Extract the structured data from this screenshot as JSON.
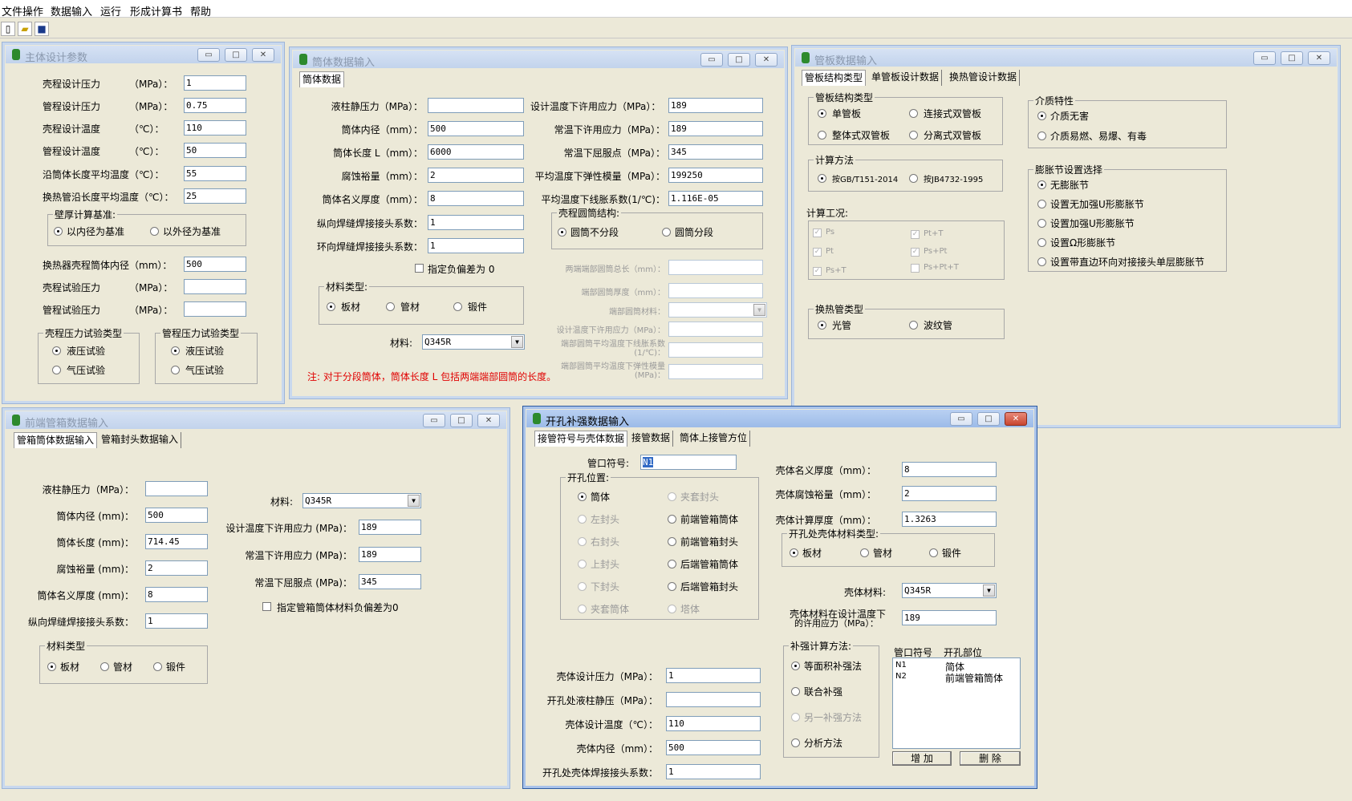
{
  "menu": {
    "items": [
      "文件操作",
      "数据输入",
      "运行",
      "形成计算书",
      "帮助"
    ]
  },
  "toolbar": {
    "new_icon": "new-file-icon",
    "open_icon": "open-folder-icon",
    "save_icon": "save-disk-icon"
  },
  "window_buttons": {
    "min": "▭",
    "max": "□",
    "close": "✕"
  },
  "w1": {
    "title": "主体设计参数",
    "rows": [
      {
        "label": "壳程设计压力",
        "unit": "（MPa）：",
        "value": "1"
      },
      {
        "label": "管程设计压力",
        "unit": "（MPa）：",
        "value": "0.75"
      },
      {
        "label": "壳程设计温度",
        "unit": "（℃）：",
        "value": "110"
      },
      {
        "label": "管程设计温度",
        "unit": "（℃）：",
        "value": "50"
      },
      {
        "label": "沿筒体长度平均温度（℃）：",
        "unit": "",
        "value": "55"
      },
      {
        "label": "换热管沿长度平均温度（℃）：",
        "unit": "",
        "value": "25"
      }
    ],
    "wall_group": {
      "title": "壁厚计算基准:",
      "opt1": "以内径为基准",
      "opt2": "以外径为基准"
    },
    "rows2": [
      {
        "label": "换热器壳程筒体内径（mm）：",
        "value": "500"
      },
      {
        "label": "壳程试验压力",
        "unit": "（MPa）：",
        "value": ""
      },
      {
        "label": "管程试验压力",
        "unit": "（MPa）：",
        "value": ""
      }
    ],
    "shell_test": {
      "title": "壳程压力试验类型",
      "opt1": "液压试验",
      "opt2": "气压试验"
    },
    "tube_test": {
      "title": "管程压力试验类型",
      "opt1": "液压试验",
      "opt2": "气压试验"
    }
  },
  "w2": {
    "title": "筒体数据输入",
    "tab": "筒体数据",
    "left_rows": [
      {
        "label": "液柱静压力（MPa）：",
        "value": ""
      },
      {
        "label": "筒体内径（mm）：",
        "value": "500"
      },
      {
        "label": "筒体长度 L（mm）：",
        "value": "6000"
      },
      {
        "label": "腐蚀裕量（mm）：",
        "value": "2"
      },
      {
        "label": "筒体名义厚度（mm）：",
        "value": "8"
      },
      {
        "label": "纵向焊缝焊接接头系数：",
        "value": "1"
      },
      {
        "label": "环向焊缝焊接接头系数：",
        "value": "1"
      }
    ],
    "neg_dev": "指定负偏差为 0",
    "mat_group": {
      "title": "材料类型:",
      "opt1": "板材",
      "opt2": "管材",
      "opt3": "锻件"
    },
    "material_label": "材料:",
    "material": "Q345R",
    "note": "注: 对于分段筒体，筒体长度 L 包括两端端部圆筒的长度。",
    "right_rows": [
      {
        "label": "设计温度下许用应力（MPa）：",
        "value": "189"
      },
      {
        "label": "常温下许用应力（MPa）：",
        "value": "189"
      },
      {
        "label": "常温下屈服点（MPa）：",
        "value": "345"
      },
      {
        "label": "平均温度下弹性模量（MPa）：",
        "value": "199250"
      },
      {
        "label": "平均温度下线胀系数(1/℃)：",
        "value": "1.116E-05"
      }
    ],
    "struct_group": {
      "title": "壳程圆筒结构:",
      "opt1": "圆筒不分段",
      "opt2": "圆筒分段"
    },
    "gray_rows": [
      "两端端部圆筒总长（mm）：",
      "端部圆筒厚度（mm）：",
      "端部圆筒材料：",
      "设计温度下许用应力（MPa）：",
      "端部圆筒平均温度下线胀系数(1/℃)：",
      "端部圆筒平均温度下弹性模量(MPa)："
    ]
  },
  "w3": {
    "title": "管板数据输入",
    "tabs": [
      "管板结构类型",
      "单管板设计数据",
      "换热管设计数据"
    ],
    "struct": {
      "title": "管板结构类型",
      "opts": [
        "单管板",
        "连接式双管板",
        "整体式双管板",
        "分离式双管板"
      ]
    },
    "calc": {
      "title": "计算方法",
      "opt1": "按GB/T151-2014",
      "opt2": "按JB4732-1995"
    },
    "cond_title": "计算工况:",
    "conds": [
      "Ps",
      "Pt+T",
      "Pt",
      "Ps+Pt",
      "Ps+T",
      "Ps+Pt+T"
    ],
    "tube": {
      "title": "换热管类型",
      "opt1": "光管",
      "opt2": "波纹管"
    },
    "medium": {
      "title": "介质特性",
      "opt1": "介质无害",
      "opt2": "介质易燃、易爆、有毒"
    },
    "joint": {
      "title": "膨胀节设置选择",
      "opts": [
        "无膨胀节",
        "设置无加强U形膨胀节",
        "设置加强U形膨胀节",
        "设置Ω形膨胀节",
        "设置带直边环向对接接头单层膨胀节"
      ]
    }
  },
  "w4": {
    "title": "前端管箱数据输入",
    "tabs": [
      "管箱筒体数据输入",
      "管箱封头数据输入"
    ],
    "left_rows": [
      {
        "label": "液柱静压力（MPa）：",
        "value": ""
      },
      {
        "label": "筒体内径  (mm)：",
        "value": "500"
      },
      {
        "label": "筒体长度  (mm)：",
        "value": "714.45"
      },
      {
        "label": "腐蚀裕量  (mm)：",
        "value": "2"
      },
      {
        "label": "筒体名义厚度  (mm)：",
        "value": "8"
      },
      {
        "label": "纵向焊缝焊接接头系数：",
        "value": "1"
      }
    ],
    "material_label": "材料:",
    "material": "Q345R",
    "right_rows": [
      {
        "label": "设计温度下许用应力 (MPa)：",
        "value": "189"
      },
      {
        "label": "常温下许用应力 (MPa)：",
        "value": "189"
      },
      {
        "label": "常温下屈服点 (MPa)：",
        "value": "345"
      }
    ],
    "neg_dev": "指定管箱筒体材料负偏差为0",
    "mat_group": {
      "title": "材料类型",
      "opt1": "板材",
      "opt2": "管材",
      "opt3": "锻件"
    }
  },
  "w5": {
    "title": "开孔补强数据输入",
    "tabs": [
      "接管符号与壳体数据",
      "接管数据",
      "筒体上接管方位"
    ],
    "nozzle_label": "管口符号:",
    "nozzle_value": "N1",
    "pos_group": {
      "title": "开孔位置:",
      "opts": [
        "筒体",
        "夹套封头",
        "左封头",
        "前端管箱筒体",
        "右封头",
        "前端管箱封头",
        "上封头",
        "后端管箱筒体",
        "下封头",
        "后端管箱封头",
        "夹套筒体",
        "塔体"
      ]
    },
    "right_rows": [
      {
        "label": "壳体名义厚度（mm）：",
        "value": "8"
      },
      {
        "label": "壳体腐蚀裕量（mm）：",
        "value": "2"
      },
      {
        "label": "壳体计算厚度（mm）：",
        "value": "1.3263"
      }
    ],
    "shell_mat": {
      "title": "开孔处壳体材料类型:",
      "opt1": "板材",
      "opt2": "管材",
      "opt3": "锻件"
    },
    "shell_material_label": "壳体材料:",
    "shell_material": "Q345R",
    "allow_label1": "壳体材料在设计温度下",
    "allow_label2": "的许用应力（MPa）：",
    "allow_value": "189",
    "method": {
      "title": "补强计算方法:",
      "opts": [
        "等面积补强法",
        "联合补强",
        "另一补强方法",
        "分析方法"
      ]
    },
    "list_header": {
      "c1": "管口符号",
      "c2": "开孔部位"
    },
    "list_rows": [
      {
        "c1": "N1",
        "c2": "简体"
      },
      {
        "c1": "N2",
        "c2": "前端管箱筒体"
      }
    ],
    "add_btn": "增 加",
    "del_btn": "删 除",
    "bottom_rows": [
      {
        "label": "壳体设计压力（MPa）：",
        "value": "1"
      },
      {
        "label": "开孔处液柱静压（MPa）：",
        "value": ""
      },
      {
        "label": "壳体设计温度（℃）：",
        "value": "110"
      },
      {
        "label": "壳体内径（mm）：",
        "value": "500"
      },
      {
        "label": "开孔处壳体焊接接头系数：",
        "value": "1"
      }
    ]
  }
}
